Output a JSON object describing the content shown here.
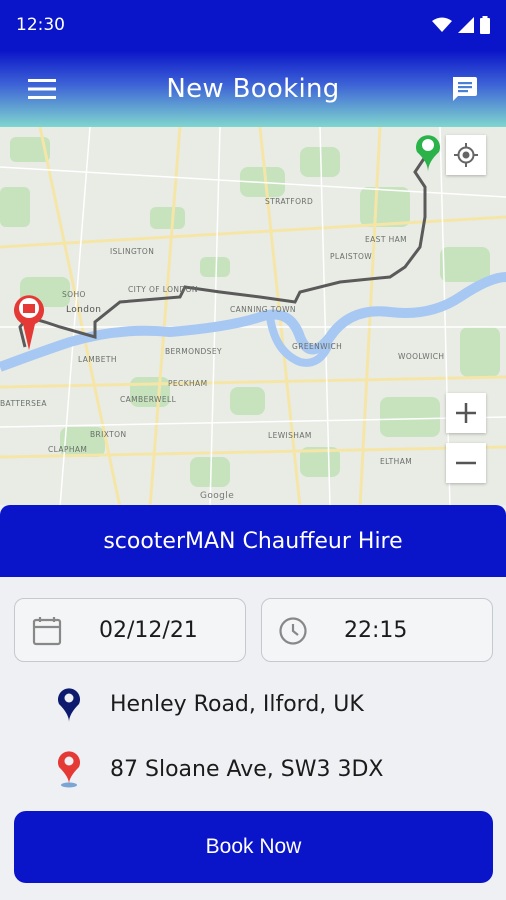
{
  "status_bar": {
    "time": "12:30"
  },
  "header": {
    "title": "New Booking"
  },
  "map": {
    "labels": [
      "ISLINGTON",
      "STRATFORD",
      "PLAISTOW",
      "EAST HAM",
      "SOHO",
      "London",
      "CITY OF LONDON",
      "CANNING TOWN",
      "LAMBETH",
      "BERMONDSEY",
      "GREENWICH",
      "WOOLWICH",
      "CAMBERWELL",
      "PECKHAM",
      "LEWISHAM",
      "BRIXTON",
      "CLAPHAM",
      "BATTERSEA",
      "ELTHAM",
      "Google"
    ],
    "route_color": "#5a5a5a"
  },
  "booking": {
    "title": "scooterMAN Chauffeur Hire",
    "date": "02/12/21",
    "time": "22:15",
    "pickup": "Henley Road, Ilford, UK",
    "dropoff": "87 Sloane Ave, SW3 3DX",
    "book_label": "Book Now"
  },
  "colors": {
    "primary": "#0a14c8",
    "pickup_pin": "#0d1a6e",
    "dropoff_pin": "#e53935"
  }
}
